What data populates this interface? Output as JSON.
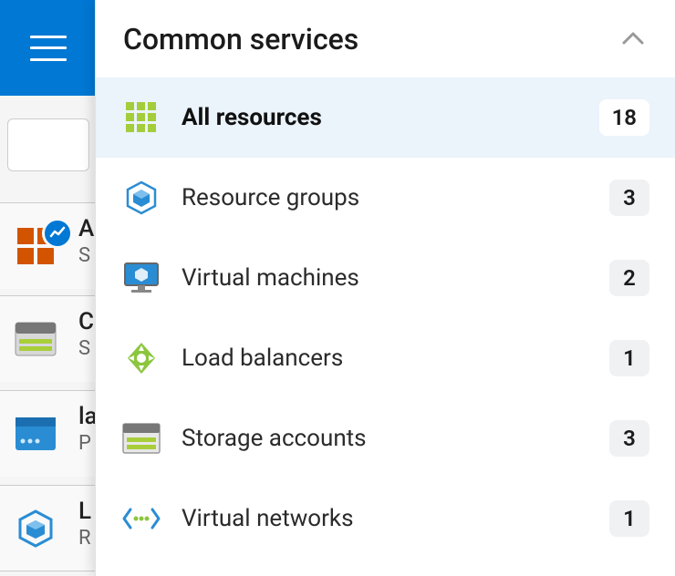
{
  "panel": {
    "title": "Common services"
  },
  "services": [
    {
      "label": "All resources",
      "count": "18"
    },
    {
      "label": "Resource groups",
      "count": "3"
    },
    {
      "label": "Virtual machines",
      "count": "2"
    },
    {
      "label": "Load balancers",
      "count": "1"
    },
    {
      "label": "Storage accounts",
      "count": "3"
    },
    {
      "label": "Virtual networks",
      "count": "1"
    }
  ],
  "bg_items": [
    {
      "title_initial": "A",
      "subtitle_initial": "S"
    },
    {
      "title_initial": "C",
      "subtitle_initial": "S"
    },
    {
      "title_initial": "la",
      "subtitle_initial": "P"
    },
    {
      "title_initial": "L",
      "subtitle_initial": "R"
    }
  ]
}
